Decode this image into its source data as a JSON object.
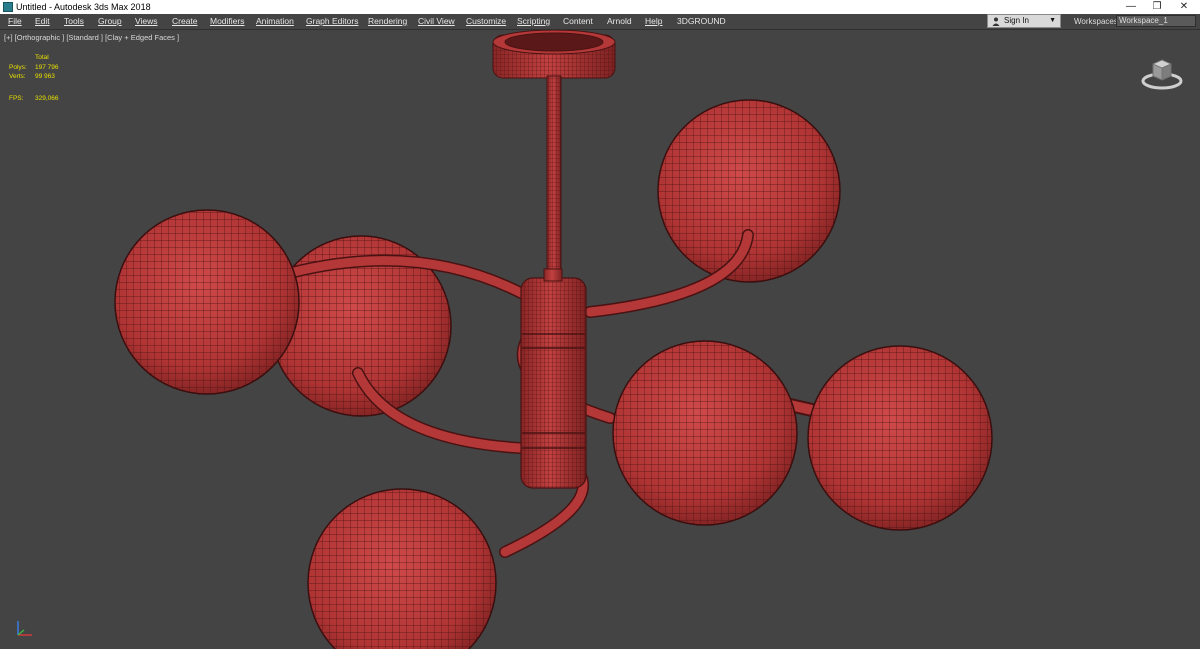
{
  "window": {
    "title": "Untitled - Autodesk 3ds Max 2018",
    "minimize_glyph": "—",
    "restore_glyph": "❐",
    "close_glyph": "✕"
  },
  "menu": {
    "items": [
      "File",
      "Edit",
      "Tools",
      "Group",
      "Views",
      "Create",
      "Modifiers",
      "Animation",
      "Graph Editors",
      "Rendering",
      "Civil View",
      "Customize",
      "Scripting",
      "Content",
      "Arnold",
      "Help",
      "3DGROUND"
    ],
    "sign_in": "Sign In",
    "workspaces_label": "Workspaces:",
    "workspace_value": "Workspace_1"
  },
  "viewport": {
    "label": "[+] [Orthographic ] [Standard ] [Clay + Edged Faces ]",
    "stats": {
      "total_label": "Total",
      "polys_label": "Polys:",
      "polys_value": "197 796",
      "verts_label": "Verts:",
      "verts_value": "99 963",
      "fps_label": "FPS:",
      "fps_value": "329,066"
    }
  },
  "colors": {
    "viewport_bg": "#444444",
    "mesh_fill": "#b53838",
    "mesh_wire": "#4a1212",
    "stats_text": "#e8e000"
  },
  "icons": [
    "app-icon",
    "person-icon",
    "viewcube-icon",
    "axis-tripod-icon"
  ]
}
